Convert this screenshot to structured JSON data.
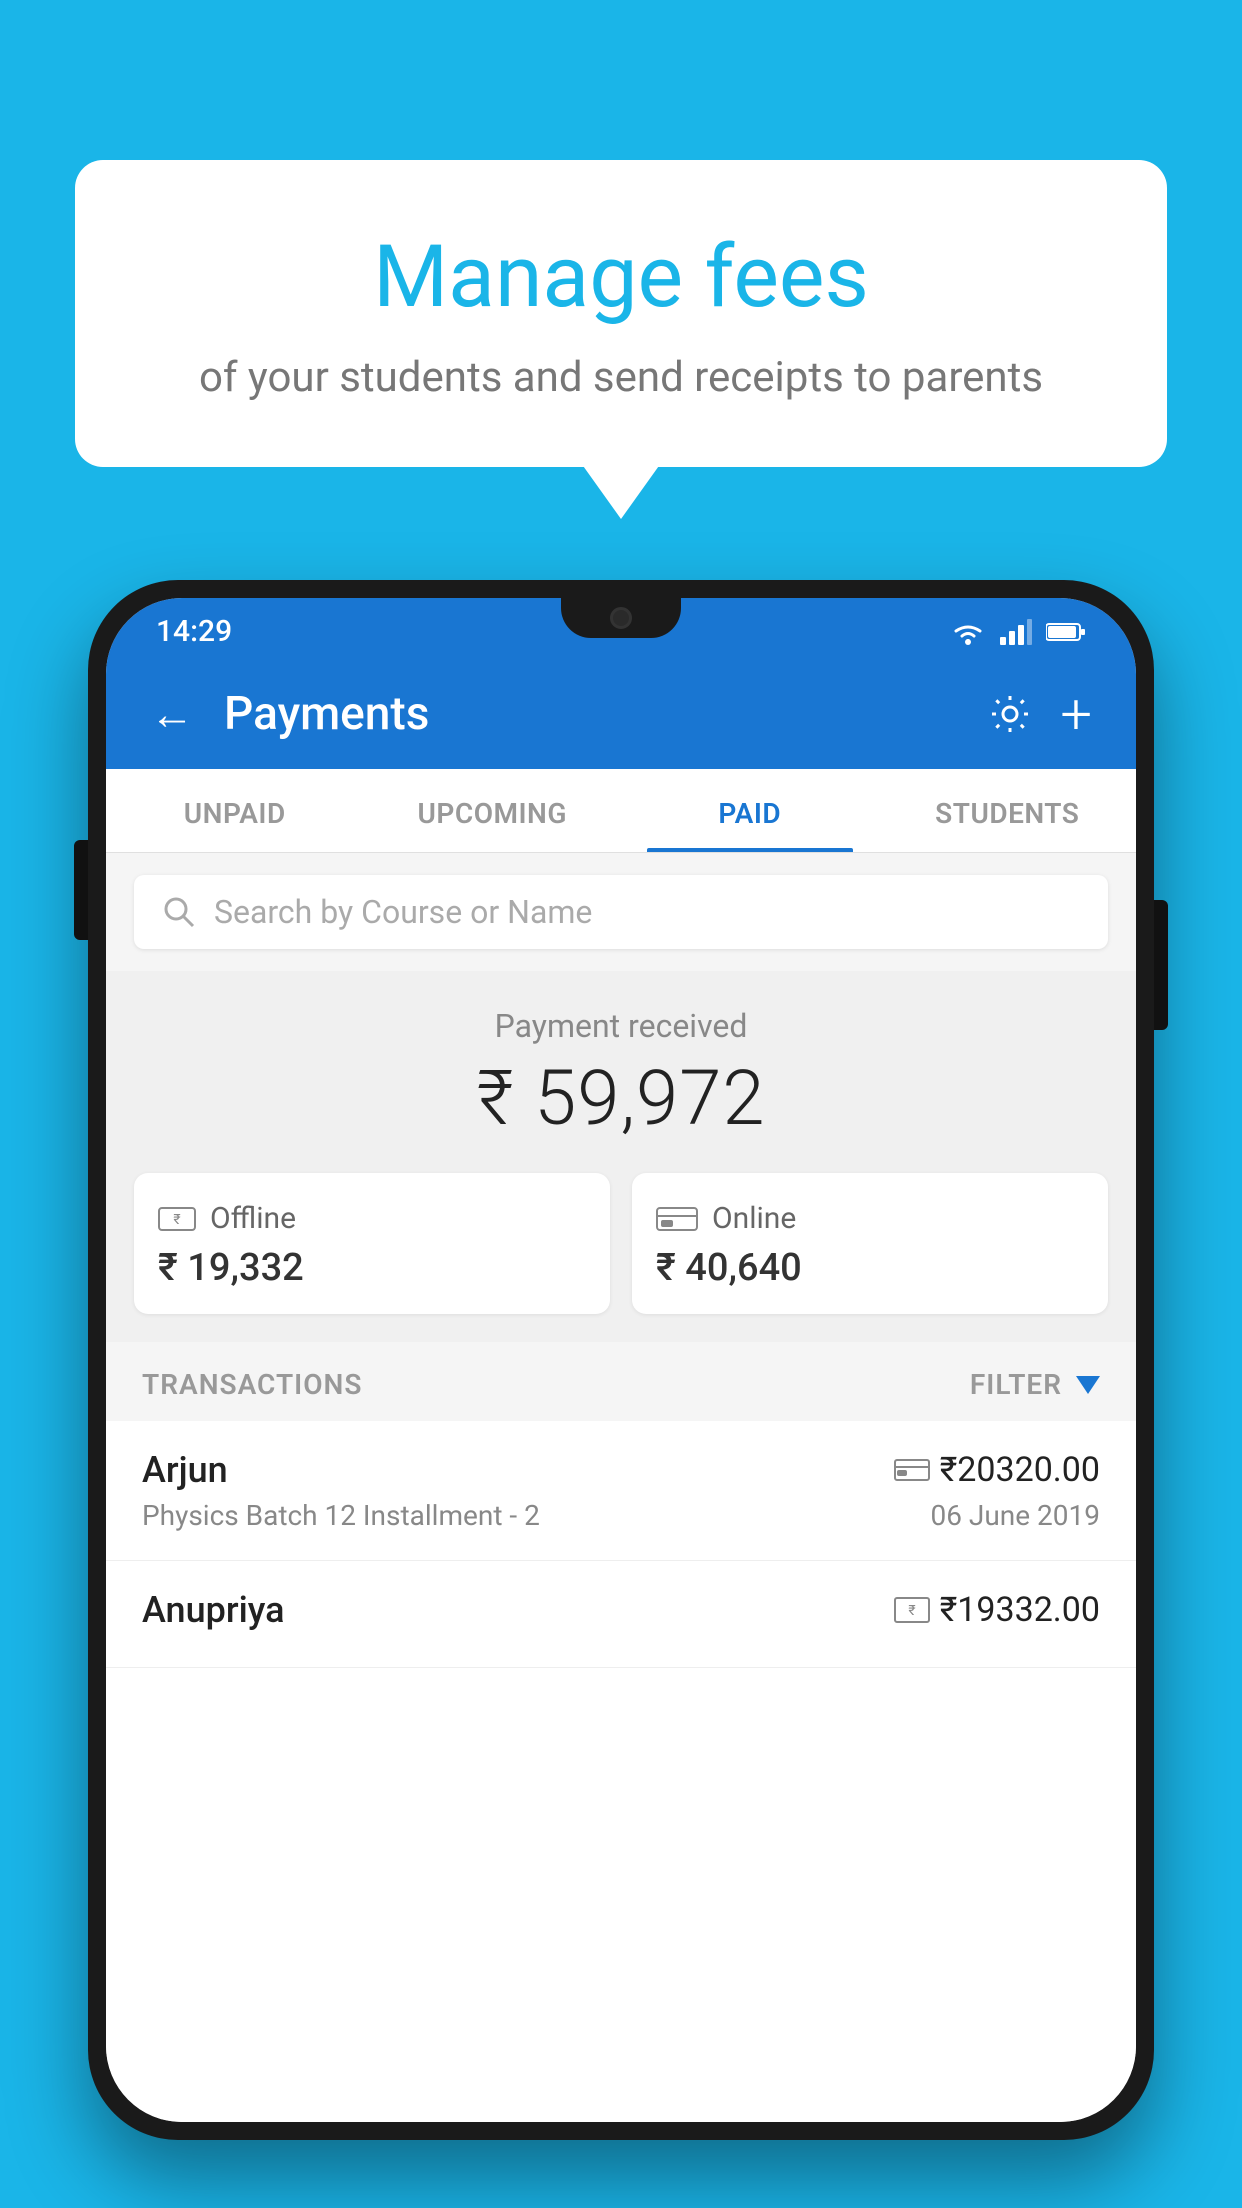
{
  "hero": {
    "title": "Manage fees",
    "subtitle": "of your students and send receipts to parents"
  },
  "status_bar": {
    "time": "14:29",
    "wifi": "wifi",
    "signal": "signal",
    "battery": "battery"
  },
  "app_bar": {
    "back_label": "←",
    "title": "Payments",
    "gear_icon": "gear",
    "plus_icon": "+"
  },
  "tabs": [
    {
      "id": "unpaid",
      "label": "UNPAID",
      "active": false
    },
    {
      "id": "upcoming",
      "label": "UPCOMING",
      "active": false
    },
    {
      "id": "paid",
      "label": "PAID",
      "active": true
    },
    {
      "id": "students",
      "label": "STUDENTS",
      "active": false
    }
  ],
  "search": {
    "placeholder": "Search by Course or Name"
  },
  "payment_summary": {
    "label": "Payment received",
    "amount": "₹ 59,972",
    "offline_label": "Offline",
    "offline_amount": "₹ 19,332",
    "online_label": "Online",
    "online_amount": "₹ 40,640"
  },
  "transactions": {
    "header_label": "TRANSACTIONS",
    "filter_label": "FILTER",
    "rows": [
      {
        "name": "Arjun",
        "amount": "₹20320.00",
        "course": "Physics Batch 12 Installment - 2",
        "date": "06 June 2019",
        "payment_type": "online"
      },
      {
        "name": "Anupriya",
        "amount": "₹19332.00",
        "course": "",
        "date": "",
        "payment_type": "offline"
      }
    ]
  }
}
